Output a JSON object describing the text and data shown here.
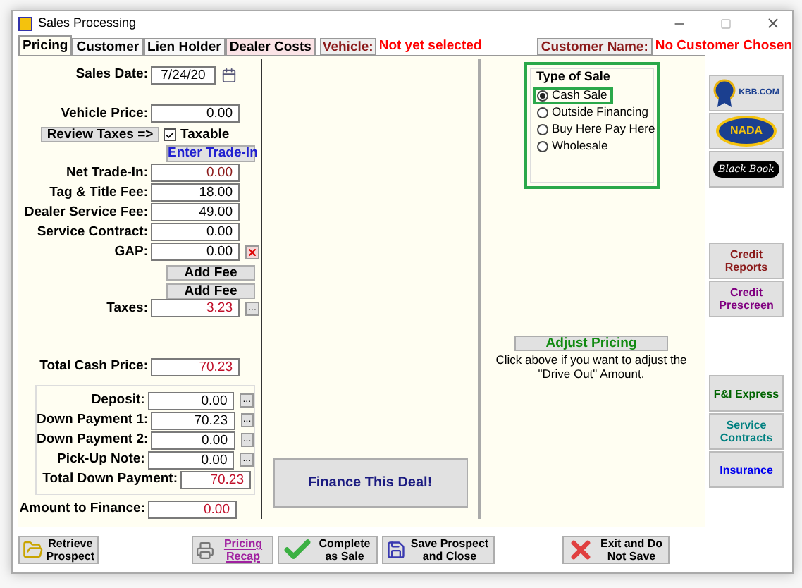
{
  "window": {
    "title": "Sales Processing"
  },
  "tabs": [
    {
      "label": "Pricing",
      "selected": true,
      "kind": "plain"
    },
    {
      "label": "Customer",
      "selected": false,
      "kind": "plain"
    },
    {
      "label": "Lien Holder",
      "selected": false,
      "kind": "plain"
    },
    {
      "label": "Dealer Costs",
      "selected": false,
      "kind": "pink"
    }
  ],
  "vehicle": {
    "label": "Vehicle:",
    "value": "Not yet selected"
  },
  "customer": {
    "label": "Customer Name:",
    "value": "No Customer Chosen"
  },
  "pricing": {
    "sales_date": {
      "label": "Sales Date:",
      "value": "7/24/20"
    },
    "vehicle_price": {
      "label": "Vehicle Price:",
      "value": "0.00",
      "color": "#000000"
    },
    "review_taxes": "Review Taxes =>",
    "taxable": {
      "label": "Taxable",
      "checked": true
    },
    "enter_trade_in": "Enter Trade-In",
    "fees": [
      {
        "label": "Net Trade-In:",
        "value": "0.00",
        "color": "#8b1a1a"
      },
      {
        "label": "Tag & Title Fee:",
        "value": "18.00",
        "color": "#000000"
      },
      {
        "label": "Dealer Service Fee:",
        "value": "49.00",
        "color": "#000000"
      },
      {
        "label": "Service Contract:",
        "value": "0.00",
        "color": "#000000"
      },
      {
        "label": "GAP:",
        "value": "0.00",
        "color": "#000000",
        "action": {
          "kind": "clear"
        }
      }
    ],
    "add_fee_buttons": [
      "Add Fee",
      "Add Fee"
    ],
    "taxes": {
      "label": "Taxes:",
      "value": "3.23",
      "color": "#c0102a",
      "action": {
        "kind": "ellipsis",
        "label": "..."
      }
    },
    "total_cash_price": {
      "label": "Total Cash Price:",
      "value": "70.23",
      "color": "#c0102a"
    },
    "down_payments": [
      {
        "label": "Deposit:",
        "value": "0.00",
        "color": "#000000",
        "action": {
          "kind": "ellipsis",
          "label": "..."
        }
      },
      {
        "label": "Down Payment 1:",
        "value": "70.23",
        "color": "#000000",
        "action": {
          "kind": "ellipsis",
          "label": "..."
        }
      },
      {
        "label": "Down Payment 2:",
        "value": "0.00",
        "color": "#000000",
        "action": {
          "kind": "ellipsis",
          "label": "..."
        }
      },
      {
        "label": "Pick-Up Note:",
        "value": "0.00",
        "color": "#000000",
        "action": {
          "kind": "ellipsis",
          "label": "..."
        }
      }
    ],
    "total_down_payment": {
      "label": "Total Down Payment:",
      "value": "70.23",
      "color": "#c0102a"
    },
    "amount_to_finance": {
      "label": "Amount to Finance:",
      "value": "0.00",
      "color": "#c0102a"
    }
  },
  "finance_button": "Finance This Deal!",
  "type_of_sale": {
    "title": "Type of Sale",
    "options": [
      {
        "label": "Cash Sale",
        "selected": true
      },
      {
        "label": "Outside Financing",
        "selected": false
      },
      {
        "label": "Buy Here Pay Here",
        "selected": false
      },
      {
        "label": "Wholesale",
        "selected": false
      }
    ]
  },
  "adjust_pricing": {
    "label": "Adjust Pricing",
    "hint": "Click above if you want to adjust the \"Drive Out\" Amount."
  },
  "logo_buttons": [
    {
      "kind": "kbb",
      "label": "KBB.COM"
    },
    {
      "kind": "nada",
      "label": "NADA"
    },
    {
      "kind": "blackbook",
      "label": "Black Book"
    }
  ],
  "side_buttons": [
    {
      "label": "Credit Reports",
      "color": "#8b1a1a"
    },
    {
      "label": "Credit Prescreen",
      "color": "#800080"
    }
  ],
  "side_buttons_lower": [
    {
      "label": "F&I Express",
      "color": "#006400"
    },
    {
      "label": "Service Contracts",
      "color": "#008080"
    },
    {
      "label": "Insurance",
      "color": "#0000ee"
    }
  ],
  "bottom_buttons": [
    {
      "kind": "retrieve",
      "label": "Retrieve Prospect"
    },
    {
      "kind": "recap",
      "label": "Pricing Recap"
    },
    {
      "kind": "complete",
      "label": "Complete as Sale"
    },
    {
      "kind": "save",
      "label": "Save Prospect and Close"
    },
    {
      "kind": "exit",
      "label": "Exit and Do Not Save"
    }
  ]
}
